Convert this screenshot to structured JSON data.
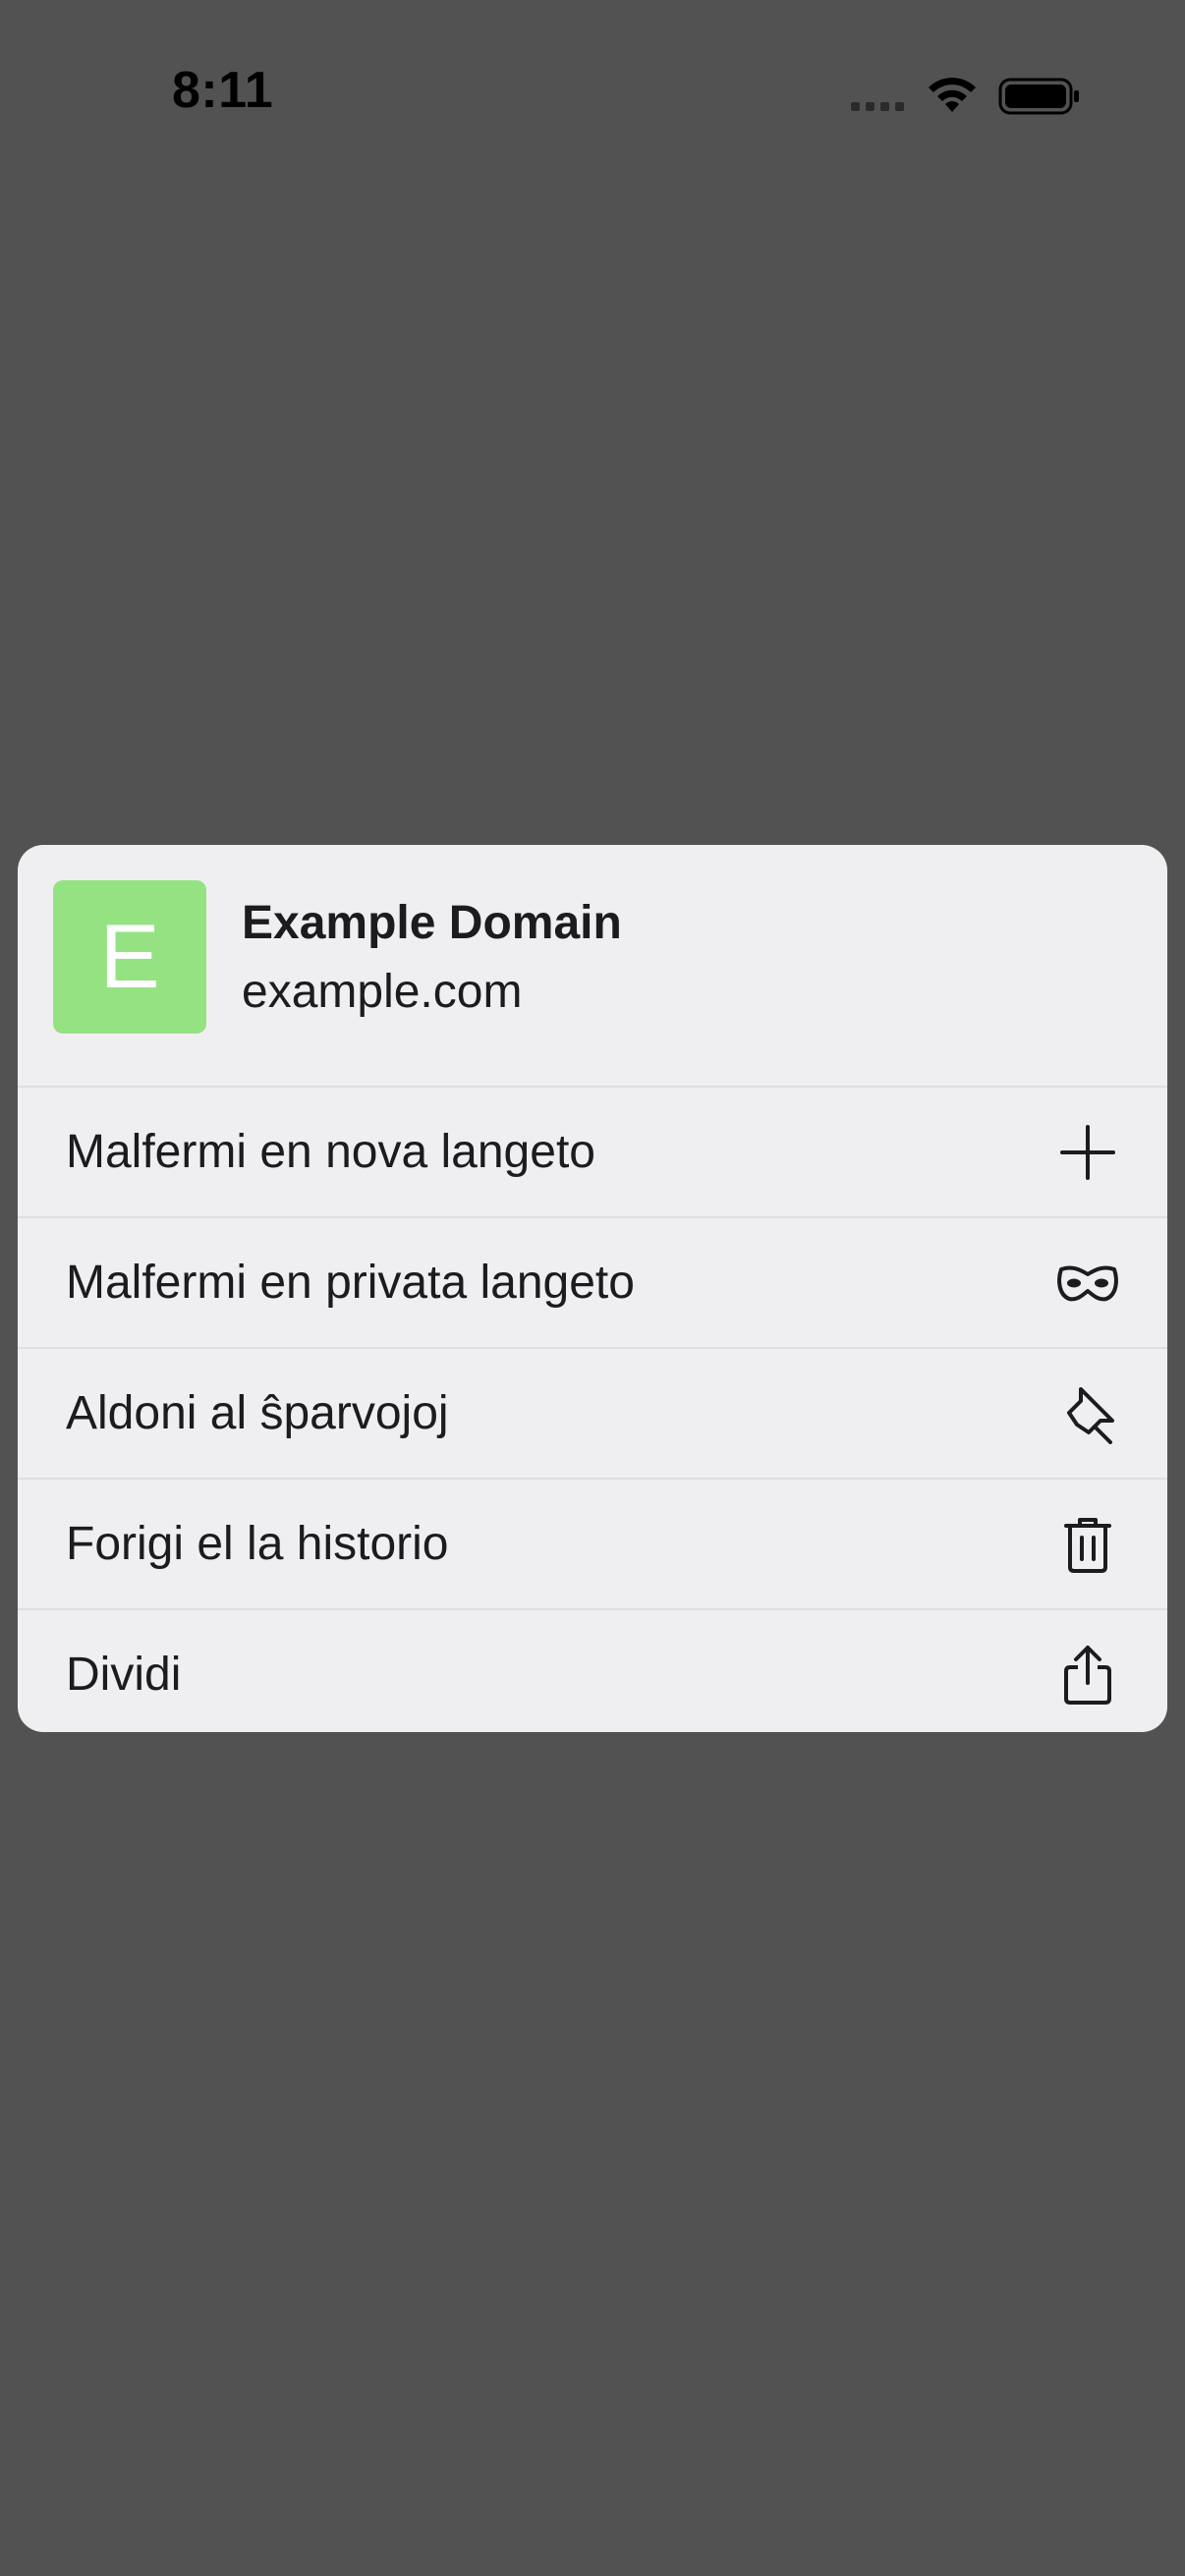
{
  "status_bar": {
    "time": "8:11"
  },
  "context_menu": {
    "site": {
      "favicon_letter": "E",
      "favicon_color": "#95e283",
      "title": "Example Domain",
      "url": "example.com"
    },
    "items": [
      {
        "label": "Malfermi en nova langeto",
        "icon": "plus-icon"
      },
      {
        "label": "Malfermi en privata langeto",
        "icon": "private-mask-icon"
      },
      {
        "label": "Aldoni al ŝparvojoj",
        "icon": "pin-icon"
      },
      {
        "label": "Forigi el la historio",
        "icon": "trash-icon"
      },
      {
        "label": "Dividi",
        "icon": "share-icon"
      }
    ]
  },
  "colors": {
    "background": "#525252",
    "menu_background": "#efeff1",
    "text": "#1c1c1e"
  }
}
